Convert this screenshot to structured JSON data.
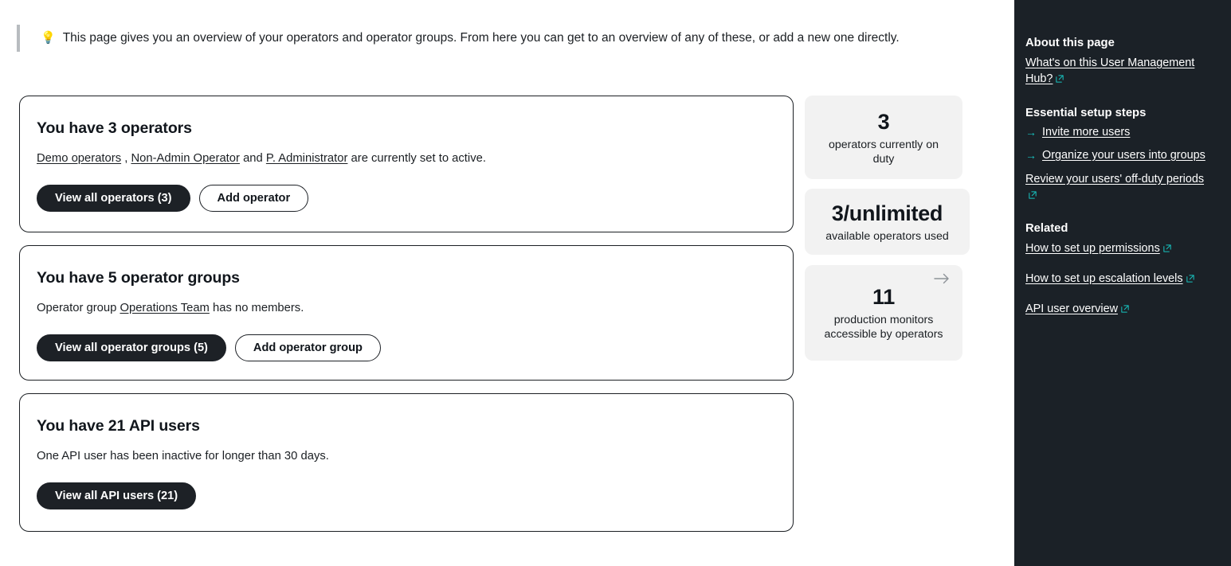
{
  "banner": {
    "icon": "lightbulb-emoji",
    "text": "This page gives you an overview of your operators and operator groups. From here you can get to an overview of any of these, or add a new one directly."
  },
  "cards": {
    "operators": {
      "title": "You have 3 operators",
      "desc_links": [
        "Demo operators",
        "Non-Admin Operator",
        "P. Administrator"
      ],
      "desc_sep1": " , ",
      "desc_sep2": " and ",
      "desc_tail": " are currently set to active.",
      "primary_button": "View all operators (3)",
      "secondary_button": "Add operator"
    },
    "groups": {
      "title": "You have 5 operator groups",
      "desc_prefix": "Operator group ",
      "desc_link": "Operations Team",
      "desc_tail": " has no members.",
      "primary_button": "View all operator groups (5)",
      "secondary_button": "Add operator group"
    },
    "api_users": {
      "title": "You have 21 API users",
      "desc": "One API user has been inactive for longer than 30 days.",
      "primary_button": "View all API users (21)"
    }
  },
  "stats": [
    {
      "value": "3",
      "label": "operators currently on duty",
      "has_arrow": false
    },
    {
      "value": "3/unlimited",
      "label": "available operators used",
      "has_arrow": false
    },
    {
      "value": "11",
      "label": "production monitors accessible by operators",
      "has_arrow": true,
      "arrow_icon": "arrow-right-icon"
    }
  ],
  "sidebar": {
    "about_heading": "About this page",
    "about_link": "What's on this User Management Hub?",
    "essential_heading": "Essential setup steps",
    "essential_links": [
      {
        "label": "Invite more users",
        "arrow": true,
        "external": false
      },
      {
        "label": "Organize your users into groups",
        "arrow": true,
        "external": false
      },
      {
        "label": "Review your users' off-duty periods",
        "arrow": false,
        "external": true
      }
    ],
    "related_heading": "Related",
    "related_links": [
      "How to set up permissions",
      "How to set up escalation levels",
      "API user overview"
    ]
  },
  "colors": {
    "accent_teal": "#17c3c0",
    "sidebar_bg": "#1b2127",
    "button_dark": "#1d2126",
    "stat_bg": "#f2f2f2"
  }
}
